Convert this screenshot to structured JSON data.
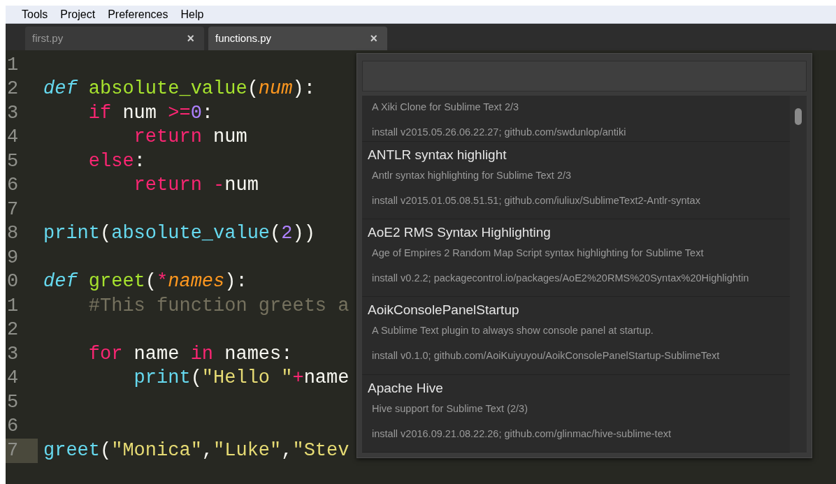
{
  "menu": [
    "Tools",
    "Project",
    "Preferences",
    "Help"
  ],
  "tabs": [
    {
      "label": "first.py",
      "selected": false,
      "close": "×"
    },
    {
      "label": "functions.py",
      "selected": true,
      "close": "×"
    }
  ],
  "editor": {
    "lines": [
      {
        "number": "1",
        "current": false
      },
      {
        "number": "2",
        "current": false,
        "tokens": [
          {
            "text": "def ",
            "kind": "storage"
          },
          {
            "text": "absolute_value",
            "kind": "function"
          },
          {
            "text": "(",
            "kind": "plain"
          },
          {
            "text": "num",
            "kind": "param"
          },
          {
            "text": "):",
            "kind": "plain"
          }
        ]
      },
      {
        "number": "3",
        "current": false,
        "tokens": [
          {
            "text": "    if",
            "kind": "keyword"
          },
          {
            "text": " num ",
            "kind": "plain"
          },
          {
            "text": ">=",
            "kind": "keyword"
          },
          {
            "text": "0",
            "kind": "number"
          },
          {
            "text": ":",
            "kind": "plain"
          }
        ]
      },
      {
        "number": "4",
        "current": false,
        "tokens": [
          {
            "text": "        return",
            "kind": "keyword"
          },
          {
            "text": " num",
            "kind": "plain"
          }
        ]
      },
      {
        "number": "5",
        "current": false,
        "tokens": [
          {
            "text": "    else",
            "kind": "keyword"
          },
          {
            "text": ":",
            "kind": "plain"
          }
        ]
      },
      {
        "number": "6",
        "current": false,
        "tokens": [
          {
            "text": "        return -",
            "kind": "keyword"
          },
          {
            "text": "num",
            "kind": "plain"
          }
        ]
      },
      {
        "number": "7",
        "current": false
      },
      {
        "number": "8",
        "current": false,
        "tokens": [
          {
            "text": "print",
            "kind": "builtin"
          },
          {
            "text": "(",
            "kind": "plain"
          },
          {
            "text": "absolute_value",
            "kind": "builtin"
          },
          {
            "text": "(",
            "kind": "plain"
          },
          {
            "text": "2",
            "kind": "number"
          },
          {
            "text": "))",
            "kind": "plain"
          }
        ]
      },
      {
        "number": "9",
        "current": false
      },
      {
        "number": "0",
        "current": false,
        "tokens": [
          {
            "text": "def ",
            "kind": "storage"
          },
          {
            "text": "greet",
            "kind": "function"
          },
          {
            "text": "(",
            "kind": "plain"
          },
          {
            "text": "*",
            "kind": "keyword"
          },
          {
            "text": "names",
            "kind": "param"
          },
          {
            "text": "):",
            "kind": "plain"
          }
        ]
      },
      {
        "number": "1",
        "current": false,
        "tokens": [
          {
            "text": "    #This function greets a",
            "kind": "comment"
          }
        ]
      },
      {
        "number": "2",
        "current": false
      },
      {
        "number": "3",
        "current": false,
        "tokens": [
          {
            "text": "    for",
            "kind": "keyword"
          },
          {
            "text": " name ",
            "kind": "plain"
          },
          {
            "text": "in",
            "kind": "keyword"
          },
          {
            "text": " names:",
            "kind": "plain"
          }
        ]
      },
      {
        "number": "4",
        "current": false,
        "tokens": [
          {
            "text": "        print",
            "kind": "builtin"
          },
          {
            "text": "(",
            "kind": "plain"
          },
          {
            "text": "\"Hello \"",
            "kind": "string"
          },
          {
            "text": "+",
            "kind": "keyword"
          },
          {
            "text": "name",
            "kind": "plain"
          }
        ]
      },
      {
        "number": "5",
        "current": false
      },
      {
        "number": "6",
        "current": false
      },
      {
        "number": "7",
        "current": true,
        "tokens": [
          {
            "text": "greet",
            "kind": "builtin"
          },
          {
            "text": "(",
            "kind": "plain"
          },
          {
            "text": "\"Monica\"",
            "kind": "string"
          },
          {
            "text": ",",
            "kind": "plain"
          },
          {
            "text": "\"Luke\"",
            "kind": "string"
          },
          {
            "text": ",",
            "kind": "plain"
          },
          {
            "text": "\"Stev",
            "kind": "string"
          }
        ]
      }
    ]
  },
  "palette": {
    "packages": [
      {
        "description": "A Xiki Clone for Sublime Text 2/3",
        "install": "install v2015.05.26.06.22.27; github.com/swdunlop/antiki"
      },
      {
        "title": "ANTLR syntax highlight",
        "description": "Antlr syntax highlighting for Sublime Text 2/3",
        "install": "install v2015.01.05.08.51.51; github.com/iuliux/SublimeText2-Antlr-syntax"
      },
      {
        "title": "AoE2 RMS Syntax Highlighting",
        "description": "Age of Empires 2 Random Map Script syntax highlighting for Sublime Text",
        "install": "install v0.2.2; packagecontrol.io/packages/AoE2%20RMS%20Syntax%20Highlightin"
      },
      {
        "title": "AoikConsolePanelStartup",
        "description": "A Sublime Text plugin to always show console panel at startup.",
        "install": "install v0.1.0; github.com/AoiKuiyuyou/AoikConsolePanelStartup-SublimeText"
      },
      {
        "title": "Apache Hive",
        "description": "Hive support for Sublime Text (2/3)",
        "install": "install v2016.09.21.08.22.26; github.com/glinmac/hive-sublime-text"
      }
    ]
  }
}
